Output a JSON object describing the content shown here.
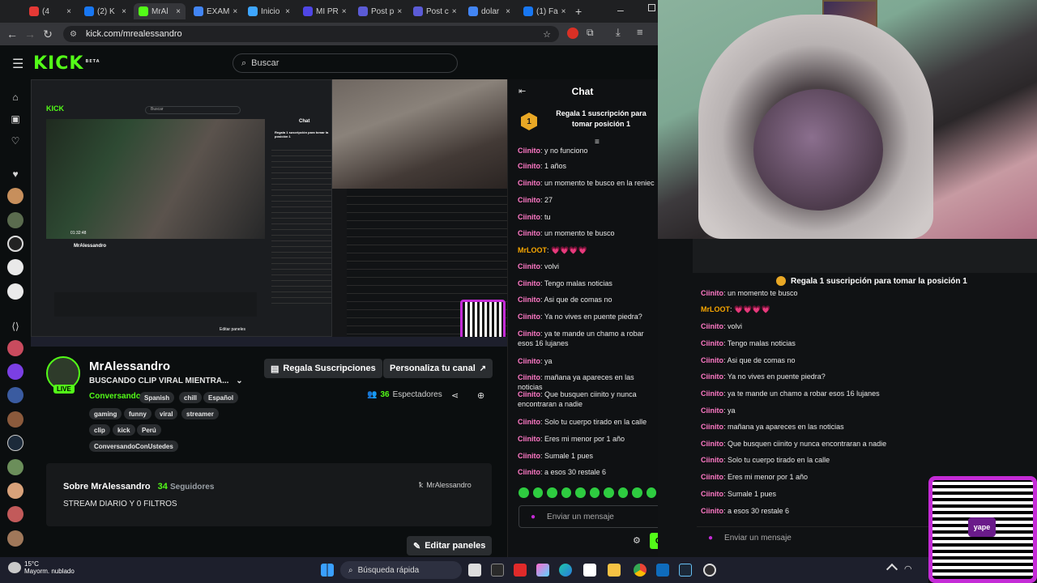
{
  "browser": {
    "tabs": [
      {
        "label": "(4",
        "color": "#e53935"
      },
      {
        "label": "(2) K",
        "color": "#1877f2"
      },
      {
        "label": "MrAl",
        "color": "#53fc18"
      },
      {
        "label": "EXAM",
        "color": "#4285f4"
      },
      {
        "label": "Inicio",
        "color": "#3ea6ff"
      },
      {
        "label": "MI PR",
        "color": "#4f46e5"
      },
      {
        "label": "Post p",
        "color": "#5b5bd6"
      },
      {
        "label": "Post c",
        "color": "#5b5bd6"
      },
      {
        "label": "dolar",
        "color": "#4285f4"
      },
      {
        "label": "(1) Fa",
        "color": "#1877f2"
      }
    ],
    "url": "kick.com/mrealessandro"
  },
  "kick": {
    "logo": "KICK",
    "beta": "BETA",
    "search_placeholder": "Buscar"
  },
  "stream_preview": {
    "inner_search": "Buscar",
    "inner_chat_title": "Chat",
    "inner_pinned": "Regala 1 suscripción para tomar la posición 1",
    "inner_channel": "MrAlessandro",
    "inner_edit": "Editar paneles",
    "inner_live_time": "01:32:48"
  },
  "channel": {
    "name": "MrAlessandro",
    "title": "BUSCANDO CLIP VIRAL MIENTRA...",
    "category": "Conversando",
    "live": "LIVE",
    "tags": [
      "Spanish",
      "chill",
      "Español",
      "gaming",
      "funny",
      "viral",
      "streamer",
      "clip",
      "kick",
      "Perú",
      "ConversandoConUstedes"
    ],
    "gift_button": "Regala Suscripciones",
    "customize_button": "Personaliza tu canal",
    "viewers_count": "36",
    "viewers_label": "Espectadores",
    "about_title": "Sobre MrAlessandro",
    "followers_count": "34",
    "followers_label": "Seguidores",
    "about_desc": "STREAM DIARIO Y 0 FILTROS",
    "kick_handle": "MrAlessandro",
    "edit_panels": "Editar paneles"
  },
  "chat": {
    "title": "Chat",
    "pinned_rank": "1",
    "pinned_text": "Regala 1 suscripción para tomar posición 1",
    "messages": [
      {
        "user": "Ciinito",
        "text": "y no funciono"
      },
      {
        "user": "Ciinito",
        "text": "1 años"
      },
      {
        "user": "Ciinito",
        "text": "un momento te busco en la reniec"
      },
      {
        "user": "Ciinito",
        "text": "27"
      },
      {
        "user": "Ciinito",
        "text": "tu"
      },
      {
        "user": "Ciinito",
        "text": "un momento te busco"
      },
      {
        "user": "MrLOOT",
        "text": "💗💗💗💗"
      },
      {
        "user": "Ciinito",
        "text": "volvi"
      },
      {
        "user": "Ciinito",
        "text": "Tengo malas noticias"
      },
      {
        "user": "Ciinito",
        "text": "Asi que de comas no"
      },
      {
        "user": "Ciinito",
        "text": "Ya no vives en puente piedra?"
      },
      {
        "user": "Ciinito",
        "text": "ya te mande un chamo a robar esos 16 lujanes"
      },
      {
        "user": "Ciinito",
        "text": "ya"
      },
      {
        "user": "Ciinito",
        "text": "mañana ya apareces en las noticias"
      },
      {
        "user": "Ciinito",
        "text": "Que busquen ciinito y nunca encontraran a nadie"
      },
      {
        "user": "Ciinito",
        "text": "Solo tu cuerpo tirado en la calle"
      },
      {
        "user": "Ciinito",
        "text": "Eres mi menor por 1 año"
      },
      {
        "user": "Ciinito",
        "text": "Sumale 1 pues"
      },
      {
        "user": "Ciinito",
        "text": "a esos 30 restale 6"
      }
    ],
    "input_placeholder": "Enviar un mensaje",
    "send_label": "Chat"
  },
  "overlay_chat": {
    "pinned_text": "Regala 1 suscripción para tomar la posición 1",
    "messages": [
      {
        "user": "Ciinito",
        "text": "un momento te busco"
      },
      {
        "user": "MrLOOT",
        "text": "💗💗💗💗"
      },
      {
        "user": "Ciinito",
        "text": "volvi"
      },
      {
        "user": "Ciinito",
        "text": "Tengo malas noticias"
      },
      {
        "user": "Ciinito",
        "text": "Asi que de comas no"
      },
      {
        "user": "Ciinito",
        "text": "Ya no vives en puente piedra?"
      },
      {
        "user": "Ciinito",
        "text": "ya te mande un chamo a robar esos 16 lujanes"
      },
      {
        "user": "Ciinito",
        "text": "ya"
      },
      {
        "user": "Ciinito",
        "text": "mañana ya apareces en las noticias"
      },
      {
        "user": "Ciinito",
        "text": "Que busquen ciinito y nunca encontraran a nadie"
      },
      {
        "user": "Ciinito",
        "text": "Solo tu cuerpo tirado en la calle"
      },
      {
        "user": "Ciinito",
        "text": "Eres mi menor por 1 año"
      },
      {
        "user": "Ciinito",
        "text": "Sumale 1 pues"
      },
      {
        "user": "Ciinito",
        "text": "a esos 30 restale 6"
      }
    ],
    "input_placeholder": "Enviar un mensaje",
    "qr_brand": "yape"
  },
  "taskbar": {
    "temp": "15°C",
    "weather": "Mayorm. nublado",
    "search": "Búsqueda rápida"
  },
  "colors": {
    "kick_green": "#53fc18",
    "chat_user": "#ff79c6",
    "gold_user": "#f7a600",
    "qr_frame": "#c42bd6"
  }
}
